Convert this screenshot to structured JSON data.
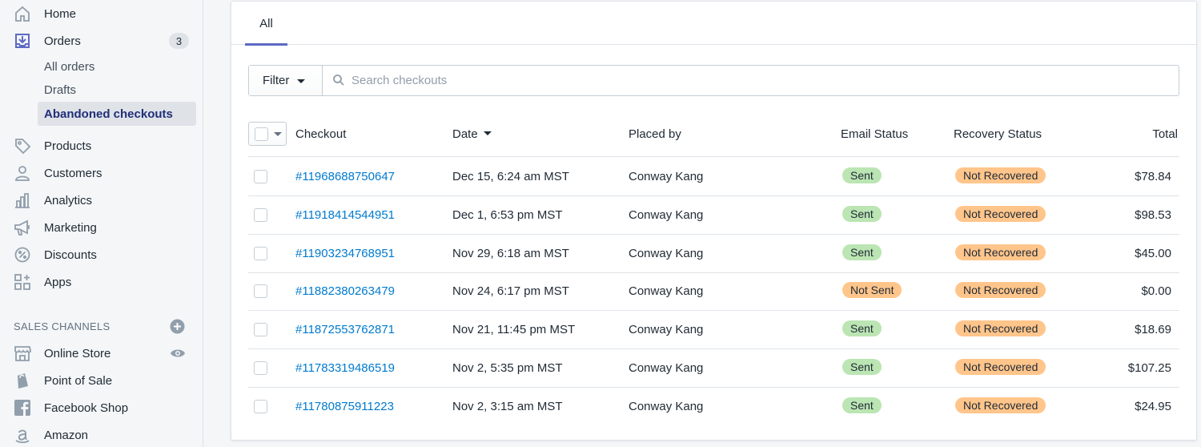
{
  "colors": {
    "accent": "#5c6ac4",
    "link": "#007ace",
    "sent_badge": "#bbe5b3",
    "not_badge": "#ffc58b",
    "sidebar_bg": "#f4f6f8",
    "active_text": "#202e78"
  },
  "sidebar": {
    "home": {
      "label": "Home",
      "icon": "home-icon"
    },
    "orders": {
      "label": "Orders",
      "icon": "orders-icon",
      "badge": "3"
    },
    "order_subitems": [
      "All orders",
      "Drafts",
      "Abandoned checkouts"
    ],
    "items": [
      {
        "label": "Products",
        "icon": "tag-icon"
      },
      {
        "label": "Customers",
        "icon": "person-icon"
      },
      {
        "label": "Analytics",
        "icon": "bar-chart-icon"
      },
      {
        "label": "Marketing",
        "icon": "megaphone-icon"
      },
      {
        "label": "Discounts",
        "icon": "discount-icon"
      },
      {
        "label": "Apps",
        "icon": "apps-icon"
      }
    ],
    "sales_channels_title": "SALES CHANNELS",
    "channels": [
      {
        "label": "Online Store",
        "icon": "store-icon"
      },
      {
        "label": "Point of Sale",
        "icon": "shopping-bag-icon"
      },
      {
        "label": "Facebook Shop",
        "icon": "facebook-icon"
      },
      {
        "label": "Amazon",
        "icon": "amazon-icon"
      }
    ]
  },
  "tabs": [
    {
      "label": "All",
      "selected": true
    }
  ],
  "filter": {
    "label": "Filter",
    "search_placeholder": "Search checkouts"
  },
  "table": {
    "columns": [
      "Checkout",
      "Date",
      "Placed by",
      "Email Status",
      "Recovery Status",
      "Total"
    ],
    "sorted_column": "Date",
    "rows": [
      {
        "checkout": "#11968688750647",
        "date": "Dec 15, 6:24 am MST",
        "placed_by": "Conway Kang",
        "email_status": "Sent",
        "recovery_status": "Not Recovered",
        "total": "$78.84"
      },
      {
        "checkout": "#11918414544951",
        "date": "Dec 1, 6:53 pm MST",
        "placed_by": "Conway Kang",
        "email_status": "Sent",
        "recovery_status": "Not Recovered",
        "total": "$98.53"
      },
      {
        "checkout": "#11903234768951",
        "date": "Nov 29, 6:18 am MST",
        "placed_by": "Conway Kang",
        "email_status": "Sent",
        "recovery_status": "Not Recovered",
        "total": "$45.00"
      },
      {
        "checkout": "#11882380263479",
        "date": "Nov 24, 6:17 pm MST",
        "placed_by": "Conway Kang",
        "email_status": "Not Sent",
        "recovery_status": "Not Recovered",
        "total": "$0.00"
      },
      {
        "checkout": "#11872553762871",
        "date": "Nov 21, 11:45 pm MST",
        "placed_by": "Conway Kang",
        "email_status": "Sent",
        "recovery_status": "Not Recovered",
        "total": "$18.69"
      },
      {
        "checkout": "#11783319486519",
        "date": "Nov 2, 5:35 pm MST",
        "placed_by": "Conway Kang",
        "email_status": "Sent",
        "recovery_status": "Not Recovered",
        "total": "$107.25"
      },
      {
        "checkout": "#11780875911223",
        "date": "Nov 2, 3:15 am MST",
        "placed_by": "Conway Kang",
        "email_status": "Sent",
        "recovery_status": "Not Recovered",
        "total": "$24.95"
      }
    ]
  }
}
